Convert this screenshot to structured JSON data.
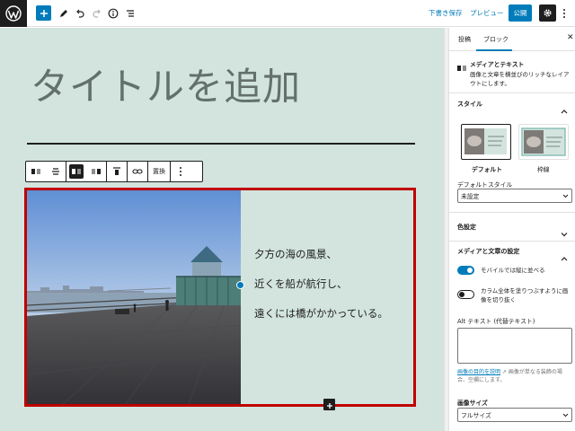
{
  "topbar": {
    "save_draft": "下書き保存",
    "preview": "プレビュー",
    "publish": "公開"
  },
  "icons": [
    "wordpress-icon",
    "plus-icon",
    "pencil-icon",
    "undo-icon",
    "redo-icon",
    "info-icon",
    "list-view-icon",
    "gear-icon",
    "more-vertical-icon"
  ],
  "colors": {
    "accent": "#007cba",
    "canvas_bg": "#d2e4dd",
    "selection_outline": "#c00000",
    "title_text": "#63706b"
  },
  "editor": {
    "title": "タイトルを追加",
    "block_toolbar": {
      "replace_label": "置換"
    },
    "media_text": {
      "lines": [
        "夕方の海の風景、",
        "近くを船が航行し、",
        "遠くには橋がかかっている。"
      ]
    }
  },
  "sidebar": {
    "tabs": [
      "投稿",
      "ブロック"
    ],
    "active_tab": "ブロック",
    "block": {
      "name": "メディアとテキスト",
      "description": "画像と文章を横並びのリッチなレイアウトにします。"
    },
    "style": {
      "heading": "スタイル",
      "options": [
        "デフォルト",
        "枠線"
      ],
      "selected": "デフォルト",
      "default_style_label": "デフォルトスタイル",
      "default_style_value": "未設定"
    },
    "color": {
      "heading": "色設定"
    },
    "media_settings": {
      "heading": "メディアと文章の設定",
      "stack_on_mobile_label": "モバイルでは縦に並べる",
      "stack_on_mobile": true,
      "crop_fill_label": "カラム全体を塗りつぶすように画像を切り抜く",
      "crop_fill": false,
      "alt_label": "Alt テキスト (代替テキスト)",
      "alt_value": "",
      "alt_help_link": "画像の目的を説明",
      "alt_help_text": "画像が単なる装飾の場合、空欄にします。",
      "image_size_label": "画像サイズ",
      "image_size_value": "フルサイズ"
    }
  }
}
